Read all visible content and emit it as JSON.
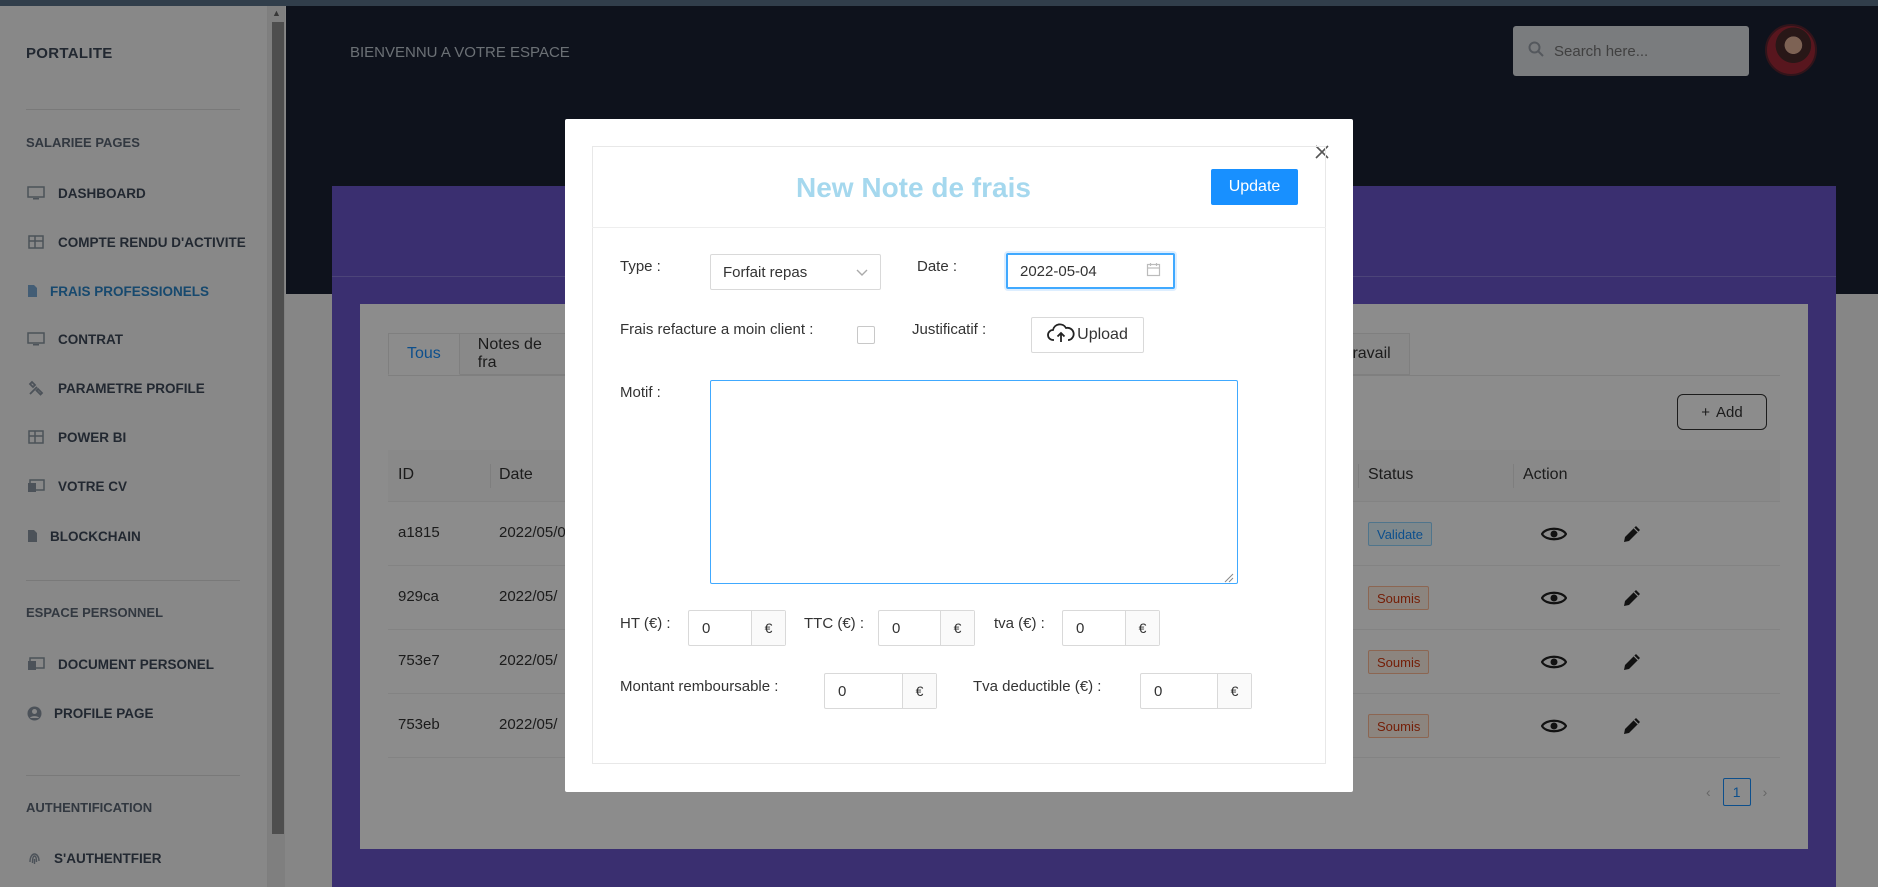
{
  "sidebar": {
    "brand": "PORTALITE",
    "section1": "SALARIEE PAGES",
    "items1": [
      {
        "label": "DASHBOARD",
        "icon": "monitor-icon"
      },
      {
        "label": "COMPTE RENDU D'ACTIVITE",
        "icon": "table-icon"
      },
      {
        "label": "FRAIS PROFESSIONELS",
        "icon": "file-icon"
      },
      {
        "label": "CONTRAT",
        "icon": "monitor-icon"
      },
      {
        "label": "PARAMETRE PROFILE",
        "icon": "tools-icon"
      },
      {
        "label": "POWER BI",
        "icon": "table-icon"
      },
      {
        "label": "VOTRE CV",
        "icon": "contacts-icon"
      },
      {
        "label": "BLOCKCHAIN",
        "icon": "file-icon"
      }
    ],
    "section2": "ESPACE PERSONNEL",
    "items2": [
      {
        "label": "DOCUMENT PERSONEL",
        "icon": "contacts-icon"
      },
      {
        "label": "PROFILE PAGE",
        "icon": "user-circle-icon"
      }
    ],
    "section3": "AUTHENTIFICATION",
    "items3": [
      {
        "label": "S'AUTHENTFIER",
        "icon": "fingerprint-icon"
      }
    ]
  },
  "header": {
    "title": "BIENVENNU A VOTRE ESPACE",
    "search_placeholder": "Search here..."
  },
  "tabs": {
    "first": "Tous",
    "second": "Notes de fra",
    "right": "travail"
  },
  "add_label": "Add",
  "table": {
    "columns": {
      "id": "ID",
      "date": "Date",
      "status": "Status",
      "action": "Action"
    },
    "rows": [
      {
        "id": "a1815",
        "date": "2022/05/0",
        "status": "Validate"
      },
      {
        "id": "929ca",
        "date": "2022/05/",
        "status": "Soumis"
      },
      {
        "id": "753e7",
        "date": "2022/05/",
        "status": "Soumis"
      },
      {
        "id": "753eb",
        "date": "2022/05/",
        "status": "Soumis"
      }
    ]
  },
  "pagination": {
    "current": "1"
  },
  "modal": {
    "title": "New Note de frais",
    "update_label": "Update",
    "type_label": "Type :",
    "type_value": "Forfait repas",
    "date_label": "Date :",
    "date_value": "2022-05-04",
    "refacture_label": "Frais refacture a moin client :",
    "justificatif_label": "Justificatif :",
    "upload_label": "Upload",
    "motif_label": "Motif :",
    "ht_label": "HT (€) :",
    "ht_value": "0",
    "ttc_label": "TTC (€) :",
    "ttc_value": "0",
    "tva_label": "tva (€) :",
    "tva_value": "0",
    "montant_label": "Montant remboursable :",
    "montant_value": "0",
    "tva_deductible_label": "Tva deductible (€) :",
    "tva_deductible_value": "0",
    "currency": "€"
  },
  "colors": {
    "accent": "#1890ff",
    "header_bg": "#1a2234",
    "purple": "#6a56cc",
    "modal_title": "#a5d8ee"
  }
}
